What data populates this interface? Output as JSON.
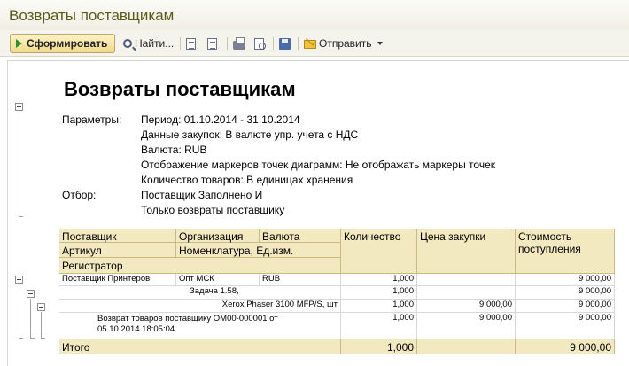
{
  "window": {
    "title": "Возвраты поставщикам"
  },
  "toolbar": {
    "generate_label": "Сформировать",
    "find_label": "Найти...",
    "send_label": "Отправить"
  },
  "report": {
    "title": "Возвраты поставщикам",
    "params_label": "Параметры:",
    "params": [
      "Период: 01.10.2014 - 31.10.2014",
      "Данные закупок: В валюте упр. учета с НДС",
      "Валюта: RUB",
      "Отображение маркеров точек диаграмм: Не отображать маркеры точек",
      "Количество товаров: В единицах хранения"
    ],
    "filter_label": "Отбор:",
    "filters": [
      "Поставщик Заполнено И",
      "Только возвраты поставщику"
    ]
  },
  "table": {
    "headers": {
      "supplier": "Поставщик",
      "organization": "Организация",
      "currency": "Валюта",
      "article": "Артикул",
      "nomenclature": "Номенклатура, Ед.изм.",
      "registrar": "Регистратор",
      "quantity": "Количество",
      "purchase_price": "Цена закупки",
      "cost_line1": "Стоимость",
      "cost_line2": "поступления"
    },
    "rows": [
      {
        "c1": "Поставщик Принтеров",
        "c2": "Опт МСК",
        "c3": "RUB",
        "qty": "1,000",
        "price": "",
        "cost": "9 000,00"
      },
      {
        "c1": "Задача 1.58,",
        "qty": "1,000",
        "price": "",
        "cost": "9 000,00"
      },
      {
        "c1": "Xerox Phaser 3100 MFP/S, шт",
        "qty": "1,000",
        "price": "9 000,00",
        "cost": "9 000,00"
      },
      {
        "c1": "Возврат товаров поставщику ОМ00-000001 от",
        "c1b": "05.10.2014 18:05:04",
        "qty": "1,000",
        "price": "9 000,00",
        "cost": "9 000,00"
      }
    ],
    "total": {
      "label": "Итого",
      "qty": "1,000",
      "cost": "9 000,00"
    }
  }
}
